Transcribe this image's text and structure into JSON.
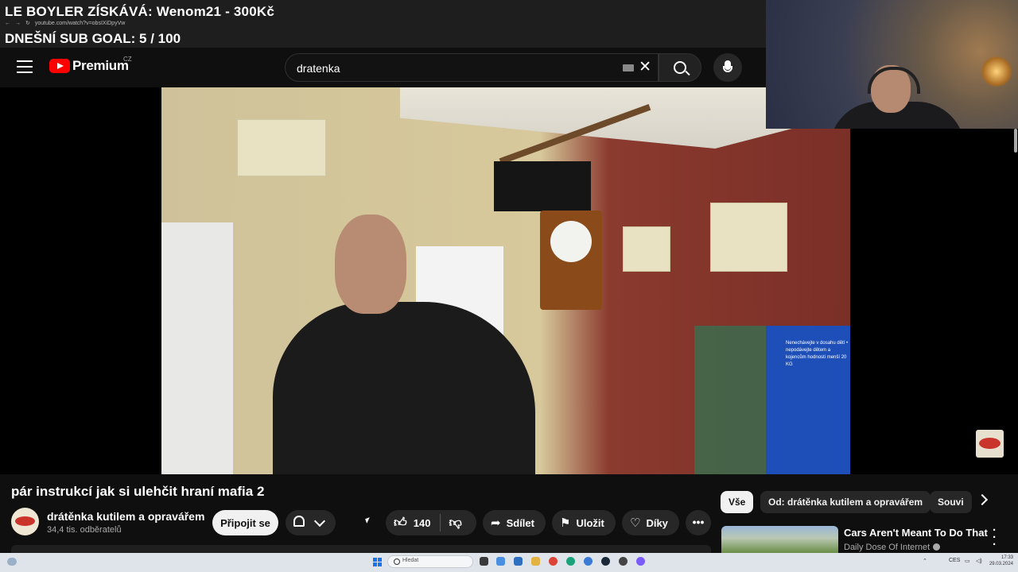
{
  "overlay": {
    "donation_line": "LE BOYLER ZÍSKÁVÁ: Wenom21 - 300Kč",
    "sub_goal_line": "DNEŠNÍ SUB GOAL:  5 / 100",
    "browser_url": "youtube.com/watch?v=obsIXiDpyVw"
  },
  "header": {
    "brand": "Premium",
    "region": "CZ",
    "search_query": "dratenka"
  },
  "video": {
    "title": "pár instrukcí jak si ulehčit hraní mafia 2",
    "bag_text": "Nenechávejte v dosahu dětí • nepodávejte dětem a kojencům hodnosti menší 20 KG"
  },
  "channel": {
    "name": "drátěnka kutilem a opravářem",
    "subscribers": "34,4 tis. odběratelů",
    "join_label": "Připojit se"
  },
  "actions": {
    "like_count": "140",
    "share_label": "Sdílet",
    "save_label": "Uložit",
    "thanks_label": "Díky",
    "more_label": "•••"
  },
  "chips": [
    {
      "label": "Vše",
      "active": true
    },
    {
      "label": "Od: drátěnka kutilem a opravářem",
      "active": false
    },
    {
      "label": "Souvi",
      "active": false
    }
  ],
  "recommendation": {
    "title": "Cars Aren't Meant To Do That",
    "channel": "Daily Dose Of Internet"
  },
  "taskbar": {
    "search_placeholder": "Hledat",
    "language": "CES",
    "time": "17:33",
    "date": "29.03.2024"
  },
  "icons": [
    "menu-icon",
    "youtube-logo-icon",
    "keyboard-icon",
    "clear-icon",
    "search-icon",
    "mic-icon",
    "bell-icon",
    "chevron-down-icon",
    "thumbs-up-icon",
    "thumbs-down-icon",
    "share-icon",
    "bookmark-icon",
    "thanks-icon",
    "more-icon",
    "chevron-right-icon",
    "verified-icon",
    "windows-start-icon"
  ],
  "colors": {
    "background": "#0f0f0f",
    "youtube_red": "#ff0000",
    "pill_bg": "#272727",
    "taskbar_bg": "#dfe3ea"
  }
}
